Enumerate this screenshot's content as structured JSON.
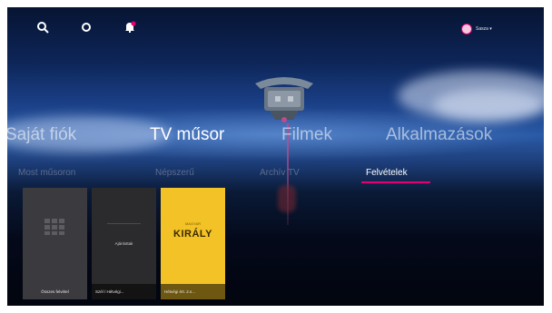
{
  "topbar": {
    "icons": [
      "search-icon",
      "settings-icon",
      "notification-bell-icon"
    ],
    "profile_name": "Sasza ▾"
  },
  "menu": {
    "items": [
      {
        "label": "Saját fiók"
      },
      {
        "label": "TV műsor"
      },
      {
        "label": "Filmek"
      },
      {
        "label": "Alkalmazások"
      }
    ]
  },
  "submenu": {
    "items": [
      {
        "label": "Most műsoron"
      },
      {
        "label": "Népszerű"
      },
      {
        "label": "Archív TV"
      },
      {
        "label": "Felvételek"
      }
    ],
    "active": "Felvételek"
  },
  "tiles": [
    {
      "caption": "Összes felvétel"
    },
    {
      "center_text": "Ajánlottak",
      "caption": "Szél / Hétvégi..."
    },
    {
      "poster_top": "MAGYAR",
      "poster_title": "KIRÁLY",
      "caption": "Hétvégi ért. 2.s..."
    }
  ],
  "colors": {
    "accent": "#e20074",
    "poster_yellow": "#f2c226"
  }
}
